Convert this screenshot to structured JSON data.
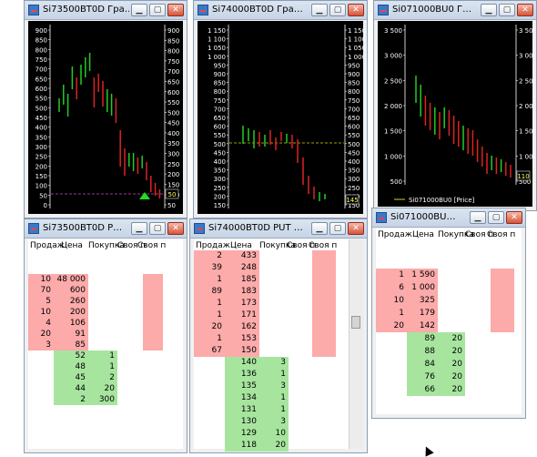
{
  "windows": {
    "chart1": {
      "title": "Si73500BT0D Гра…",
      "price_tag": "50",
      "yaxis_left": [
        "900",
        "850",
        "800",
        "750",
        "700",
        "650",
        "600",
        "550",
        "500",
        "450",
        "400",
        "350",
        "300",
        "250",
        "200",
        "150",
        "100",
        "50",
        "0"
      ],
      "yaxis_right": [
        "900",
        "850",
        "800",
        "750",
        "700",
        "650",
        "600",
        "550",
        "500",
        "450",
        "400",
        "350",
        "300",
        "250",
        "200",
        "150",
        "100",
        "50"
      ]
    },
    "chart2": {
      "title": "Si74000BT0D Гра…",
      "price_tag": "145",
      "yaxis_left": [
        "1 150",
        "1 100",
        "1 050",
        "1 000",
        "950",
        "900",
        "850",
        "800",
        "750",
        "700",
        "650",
        "600",
        "550",
        "500",
        "450",
        "400",
        "350",
        "300",
        "250",
        "200",
        "150"
      ],
      "yaxis_right": [
        "1 150",
        "1 100",
        "1 050",
        "1 000",
        "950",
        "900",
        "850",
        "800",
        "750",
        "700",
        "650",
        "600",
        "550",
        "500",
        "450",
        "400",
        "350",
        "300",
        "250",
        "200",
        "150"
      ]
    },
    "chart3": {
      "title": "Si071000BU0 Г…",
      "price_tag": "110",
      "legend": "Si071000BU0 [Price]",
      "yaxis_left": [
        "3 500",
        "3 000",
        "2 500",
        "2 000",
        "1 500",
        "1 000",
        "500"
      ],
      "yaxis_right": [
        "3 500",
        "3 000",
        "2 500",
        "2 000",
        "1 500",
        "1 000",
        "500"
      ]
    },
    "book1": {
      "title": "Si73500BT0D P…",
      "headers": [
        "Продаж",
        "Цена",
        "Покупка",
        "Своя п",
        "Своя п"
      ],
      "rows": [
        {
          "sell": "10",
          "price": "48 000",
          "buy": ""
        },
        {
          "sell": "70",
          "price": "600",
          "buy": ""
        },
        {
          "sell": "5",
          "price": "260",
          "buy": ""
        },
        {
          "sell": "10",
          "price": "200",
          "buy": ""
        },
        {
          "sell": "4",
          "price": "106",
          "buy": ""
        },
        {
          "sell": "20",
          "price": "91",
          "buy": ""
        },
        {
          "sell": "3",
          "price": "85",
          "buy": ""
        },
        {
          "sell": "",
          "price": "52",
          "buy": "1"
        },
        {
          "sell": "",
          "price": "48",
          "buy": "1"
        },
        {
          "sell": "",
          "price": "45",
          "buy": "2"
        },
        {
          "sell": "",
          "price": "44",
          "buy": "20"
        },
        {
          "sell": "",
          "price": "2",
          "buy": "300"
        }
      ]
    },
    "book2": {
      "title": "Si74000BT0D PUT …",
      "headers": [
        "Продаж",
        "Цена",
        "Покупка",
        "Своя п",
        "Своя п"
      ],
      "rows": [
        {
          "sell": "2",
          "price": "433",
          "buy": ""
        },
        {
          "sell": "39",
          "price": "248",
          "buy": ""
        },
        {
          "sell": "1",
          "price": "185",
          "buy": ""
        },
        {
          "sell": "89",
          "price": "183",
          "buy": ""
        },
        {
          "sell": "1",
          "price": "173",
          "buy": ""
        },
        {
          "sell": "1",
          "price": "171",
          "buy": ""
        },
        {
          "sell": "20",
          "price": "162",
          "buy": ""
        },
        {
          "sell": "1",
          "price": "153",
          "buy": ""
        },
        {
          "sell": "67",
          "price": "150",
          "buy": ""
        },
        {
          "sell": "",
          "price": "140",
          "buy": "3"
        },
        {
          "sell": "",
          "price": "136",
          "buy": "1"
        },
        {
          "sell": "",
          "price": "135",
          "buy": "3"
        },
        {
          "sell": "",
          "price": "134",
          "buy": "1"
        },
        {
          "sell": "",
          "price": "131",
          "buy": "1"
        },
        {
          "sell": "",
          "price": "130",
          "buy": "3"
        },
        {
          "sell": "",
          "price": "129",
          "buy": "10"
        },
        {
          "sell": "",
          "price": "118",
          "buy": "20"
        }
      ]
    },
    "book3": {
      "title": "Si071000BU…",
      "headers": [
        "Продаж",
        "Цена",
        "Покупка",
        "Своя п",
        "Своя п"
      ],
      "rows": [
        {
          "sell": "1",
          "price": "1 590",
          "buy": ""
        },
        {
          "sell": "6",
          "price": "1 000",
          "buy": ""
        },
        {
          "sell": "10",
          "price": "325",
          "buy": ""
        },
        {
          "sell": "1",
          "price": "179",
          "buy": ""
        },
        {
          "sell": "20",
          "price": "142",
          "buy": ""
        },
        {
          "sell": "",
          "price": "89",
          "buy": "20"
        },
        {
          "sell": "",
          "price": "88",
          "buy": "20"
        },
        {
          "sell": "",
          "price": "84",
          "buy": "20"
        },
        {
          "sell": "",
          "price": "76",
          "buy": "20"
        },
        {
          "sell": "",
          "price": "66",
          "buy": "20"
        }
      ]
    }
  },
  "colors": {
    "sell_bg": "#fcaaaa",
    "buy_bg": "#a7e59f",
    "chart_bg": "#000000",
    "axis_text": "#ffffff",
    "candle_up": "#22cc22",
    "candle_down": "#dd2222",
    "level_line": "#d6d600"
  },
  "icons": {
    "title_icon": "chart-window-icon",
    "minimize": "minimize-icon",
    "maximize": "maximize-icon",
    "close": "close-icon"
  }
}
